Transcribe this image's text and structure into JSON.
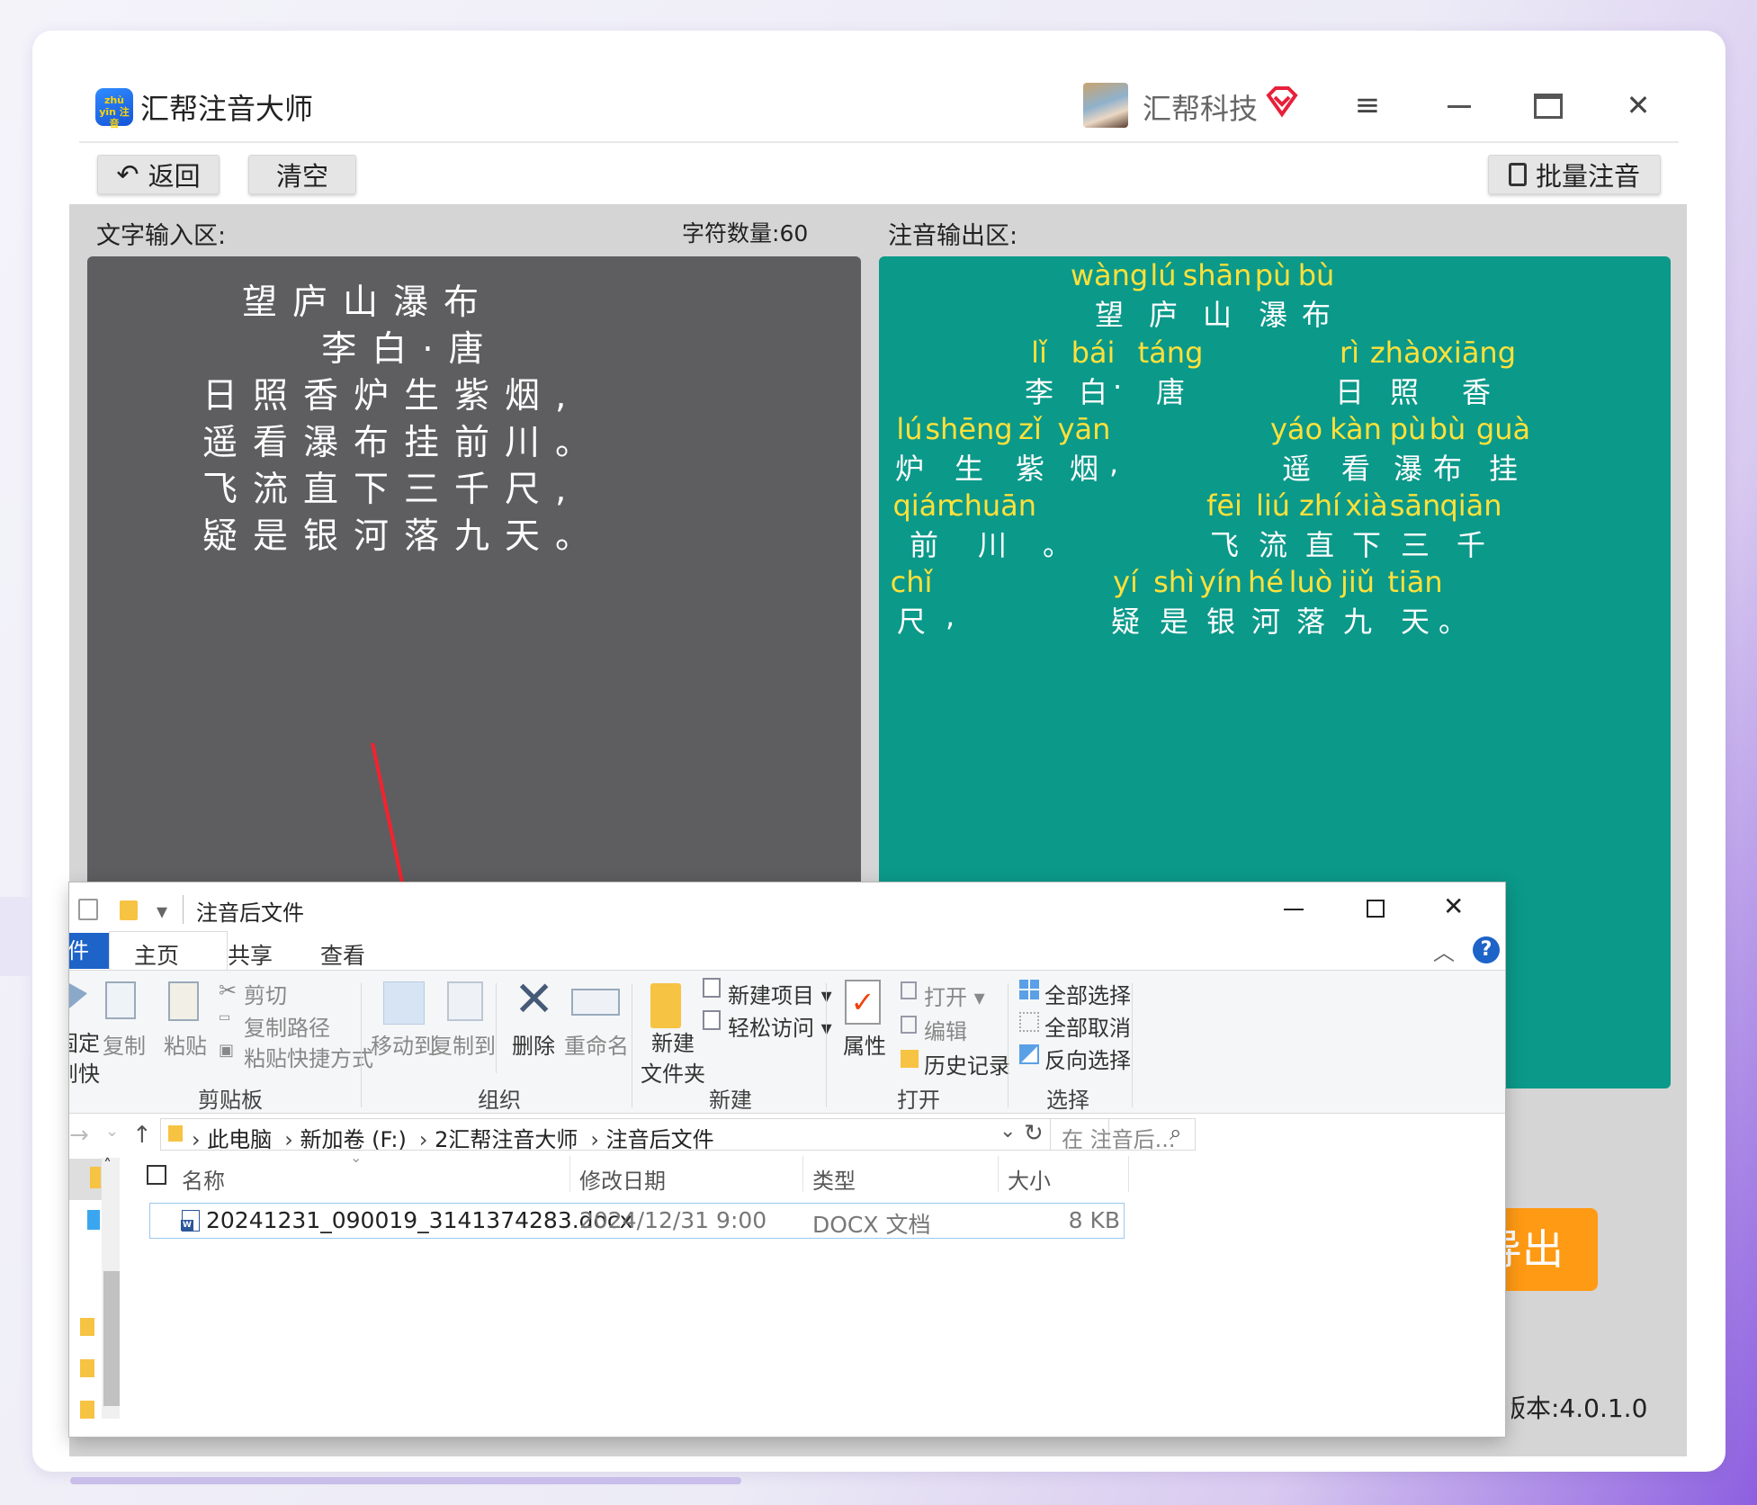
{
  "app": {
    "title": "汇帮注音大师",
    "icon_text": "zhù yīn 注音",
    "user": "汇帮科技"
  },
  "icons": {
    "app": "app-logo-icon",
    "vip": "vip-diamond-icon",
    "menu": "menu-icon",
    "minimize": "minimize-icon",
    "maximize": "maximize-icon",
    "close": "close-icon",
    "back": "back-arrow-icon",
    "batch": "document-icon"
  },
  "toolbar": {
    "back": "返回",
    "clear": "清空",
    "batch": "批量注音"
  },
  "input": {
    "label": "文字输入区:",
    "count_label": "字符数量:",
    "count": "60",
    "lines": [
      "望庐山瀑布",
      "   李白·唐",
      "日照香炉生紫烟,",
      "遥看瀑布挂前川。",
      "飞流直下三千尺,",
      "疑是银河落九天。"
    ]
  },
  "output": {
    "label": "注音输出区:",
    "rows": [
      {
        "py": [
          [
            "wàng",
            0
          ],
          [
            "lú",
            1
          ],
          [
            "shān",
            2
          ],
          [
            "pù",
            3
          ],
          [
            "bù",
            4
          ]
        ],
        "hz": [
          [
            "望",
            0
          ],
          [
            "庐",
            1
          ],
          [
            "山",
            2
          ],
          [
            "瀑",
            3
          ],
          [
            "布",
            4
          ]
        ]
      },
      {
        "py": [
          [
            "lǐ",
            5
          ],
          [
            "bái",
            6
          ],
          [
            "táng",
            8
          ],
          [
            "rì",
            9
          ],
          [
            "zhào",
            10
          ],
          [
            "xiāng",
            11
          ]
        ],
        "hz": [
          [
            "李",
            5
          ],
          [
            "白",
            6
          ],
          [
            "·",
            7
          ],
          [
            "唐",
            8
          ],
          [
            "日",
            9
          ],
          [
            "照",
            10
          ],
          [
            "香",
            11
          ]
        ]
      },
      {
        "py": [
          [
            "lú",
            12
          ],
          [
            "shēng",
            13
          ],
          [
            "zǐ",
            14
          ],
          [
            "yān",
            15
          ],
          [
            "yáo",
            17
          ],
          [
            "kàn",
            18
          ],
          [
            "pù",
            19
          ],
          [
            "bù",
            20
          ],
          [
            "guà",
            21
          ]
        ],
        "hz": [
          [
            "炉",
            12
          ],
          [
            "生",
            13
          ],
          [
            "紫",
            14
          ],
          [
            "烟",
            15
          ],
          [
            ",",
            16
          ],
          [
            "遥",
            17
          ],
          [
            "看",
            18
          ],
          [
            "瀑",
            19
          ],
          [
            "布",
            20
          ],
          [
            "挂",
            21
          ]
        ]
      },
      {
        "py": [
          [
            "qián",
            22
          ],
          [
            "chuān",
            23
          ],
          [
            "fēi",
            25
          ],
          [
            "liú",
            26
          ],
          [
            "zhí",
            27
          ],
          [
            "xià",
            28
          ],
          [
            "sān",
            29
          ],
          [
            "qiān",
            30
          ]
        ],
        "hz": [
          [
            "前",
            22
          ],
          [
            "川",
            23
          ],
          [
            "。",
            24
          ],
          [
            "飞",
            25
          ],
          [
            "流",
            26
          ],
          [
            "直",
            27
          ],
          [
            "下",
            28
          ],
          [
            "三",
            29
          ],
          [
            "千",
            30
          ]
        ]
      },
      {
        "py": [
          [
            "chǐ",
            31
          ],
          [
            "yí",
            33
          ],
          [
            "shì",
            34
          ],
          [
            "yín",
            35
          ],
          [
            "hé",
            36
          ],
          [
            "luò",
            37
          ],
          [
            "jiǔ",
            38
          ],
          [
            "tiān",
            39
          ]
        ],
        "hz": [
          [
            "尺",
            31
          ],
          [
            ",",
            32
          ],
          [
            "疑",
            33
          ],
          [
            "是",
            34
          ],
          [
            "银",
            35
          ],
          [
            "河",
            36
          ],
          [
            "落",
            37
          ],
          [
            "九",
            38
          ],
          [
            "天",
            39
          ],
          [
            "。",
            40
          ]
        ]
      }
    ]
  },
  "export": {
    "label": "导出"
  },
  "version": {
    "label": "版本:4.0.1.0"
  },
  "explorer": {
    "title": "注音后文件",
    "tabs": {
      "file": "文件",
      "home": "主页",
      "share": "共享",
      "view": "查看"
    },
    "clipboard": {
      "pin": "固定到快速访问",
      "copy": "复制",
      "paste": "粘贴",
      "cut": "剪切",
      "copy_path": "复制路径",
      "paste_shortcut": "粘贴快捷方式",
      "group": "剪贴板"
    },
    "organize": {
      "move": "移动到",
      "copy_to": "复制到",
      "delete": "删除",
      "rename": "重命名",
      "group": "组织"
    },
    "new": {
      "folder_l1": "新建",
      "folder_l2": "文件夹",
      "item": "新建项目",
      "easy": "轻松访问",
      "group": "新建"
    },
    "open": {
      "props": "属性",
      "open": "打开",
      "edit": "编辑",
      "history": "历史记录",
      "group": "打开"
    },
    "select": {
      "all": "全部选择",
      "none": "全部取消",
      "invert": "反向选择",
      "group": "选择"
    },
    "path": [
      "此电脑",
      "新加卷 (F:)",
      "2汇帮注音大师",
      "注音后文件"
    ],
    "search_placeholder": "在 注音后...",
    "columns": {
      "name": "名称",
      "date": "修改日期",
      "type": "类型",
      "size": "大小"
    },
    "files": [
      {
        "name": "20241231_090019_3141374283.docx",
        "date": "2024/12/31 9:00",
        "type": "DOCX 文档",
        "size": "8 KB"
      }
    ]
  }
}
